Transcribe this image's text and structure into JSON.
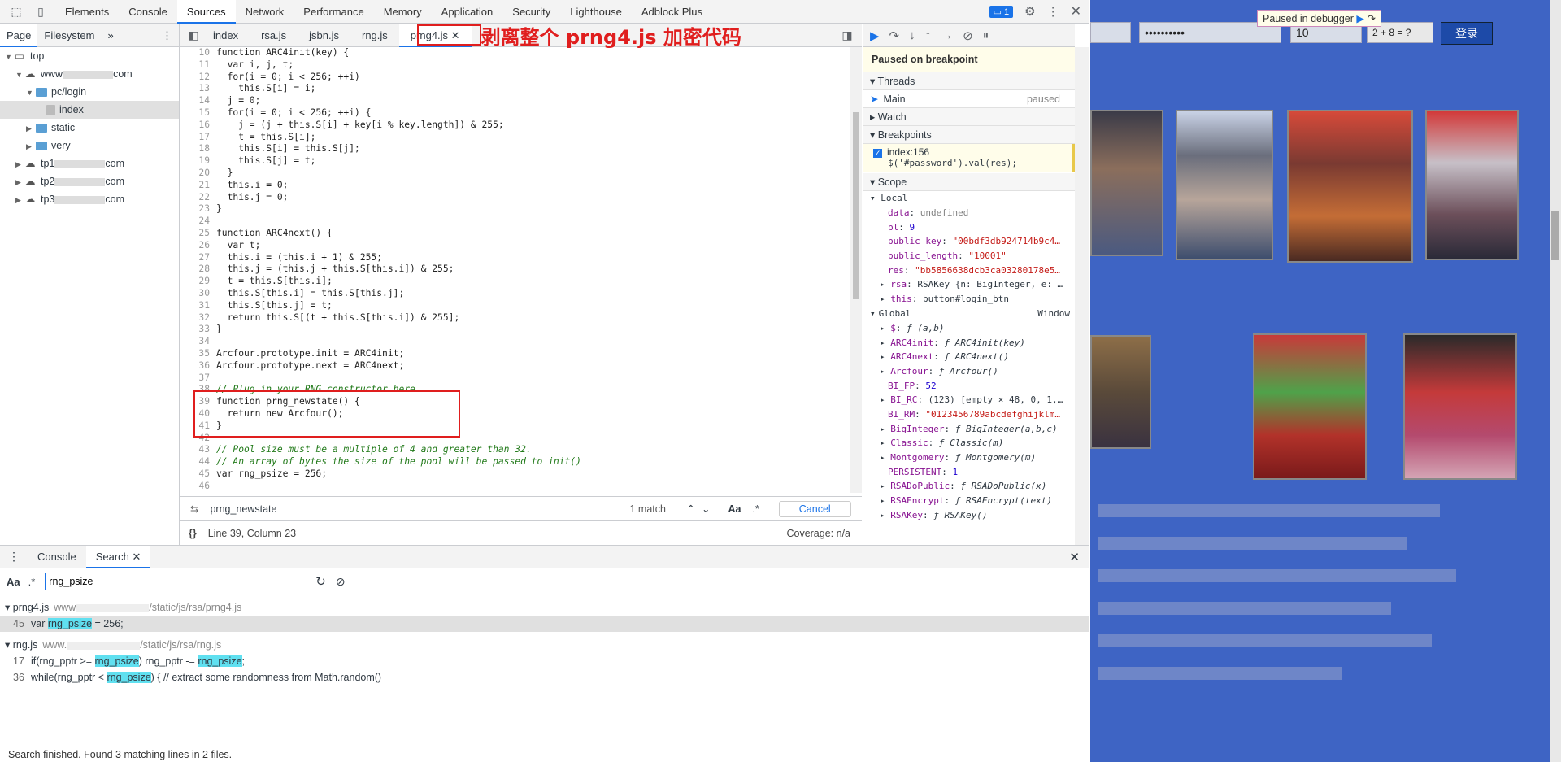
{
  "main_tabs": [
    "Elements",
    "Console",
    "Sources",
    "Network",
    "Performance",
    "Memory",
    "Application",
    "Security",
    "Lighthouse",
    "Adblock Plus"
  ],
  "issues_count": "1",
  "sidebar": {
    "tabs": [
      "Page",
      "Filesystem"
    ],
    "tree": [
      {
        "label": "top",
        "level": 0,
        "arrow": "▼"
      },
      {
        "label": "www",
        "suffix": "com",
        "level": 1,
        "arrow": "▼"
      },
      {
        "label": "pc/login",
        "level": 2,
        "arrow": "▼"
      },
      {
        "label": "index",
        "level": 3,
        "arrow": ""
      },
      {
        "label": "static",
        "level": 2,
        "arrow": "▶"
      },
      {
        "label": "very",
        "level": 2,
        "arrow": "▶"
      },
      {
        "label": "tp1",
        "suffix": "com",
        "level": 1,
        "arrow": "▶"
      },
      {
        "label": "tp2",
        "suffix": "com",
        "level": 1,
        "arrow": "▶"
      },
      {
        "label": "tp3",
        "suffix": "com",
        "level": 1,
        "arrow": "▶"
      }
    ]
  },
  "editor_tabs": [
    "index",
    "rsa.js",
    "jsbn.js",
    "rng.js",
    "prng4.js"
  ],
  "annotation": "剥离整个 prng4.js 加密代码",
  "code_lines": [
    {
      "n": "10",
      "t": "function ARC4init(key) {"
    },
    {
      "n": "11",
      "t": "  var i, j, t;"
    },
    {
      "n": "12",
      "t": "  for(i = 0; i < 256; ++i)"
    },
    {
      "n": "13",
      "t": "    this.S[i] = i;"
    },
    {
      "n": "14",
      "t": "  j = 0;"
    },
    {
      "n": "15",
      "t": "  for(i = 0; i < 256; ++i) {"
    },
    {
      "n": "16",
      "t": "    j = (j + this.S[i] + key[i % key.length]) & 255;"
    },
    {
      "n": "17",
      "t": "    t = this.S[i];"
    },
    {
      "n": "18",
      "t": "    this.S[i] = this.S[j];"
    },
    {
      "n": "19",
      "t": "    this.S[j] = t;"
    },
    {
      "n": "20",
      "t": "  }"
    },
    {
      "n": "21",
      "t": "  this.i = 0;"
    },
    {
      "n": "22",
      "t": "  this.j = 0;"
    },
    {
      "n": "23",
      "t": "}"
    },
    {
      "n": "24",
      "t": ""
    },
    {
      "n": "25",
      "t": "function ARC4next() {"
    },
    {
      "n": "26",
      "t": "  var t;"
    },
    {
      "n": "27",
      "t": "  this.i = (this.i + 1) & 255;"
    },
    {
      "n": "28",
      "t": "  this.j = (this.j + this.S[this.i]) & 255;"
    },
    {
      "n": "29",
      "t": "  t = this.S[this.i];"
    },
    {
      "n": "30",
      "t": "  this.S[this.i] = this.S[this.j];"
    },
    {
      "n": "31",
      "t": "  this.S[this.j] = t;"
    },
    {
      "n": "32",
      "t": "  return this.S[(t + this.S[this.i]) & 255];"
    },
    {
      "n": "33",
      "t": "}"
    },
    {
      "n": "34",
      "t": ""
    },
    {
      "n": "35",
      "t": "Arcfour.prototype.init = ARC4init;"
    },
    {
      "n": "36",
      "t": "Arcfour.prototype.next = ARC4next;"
    },
    {
      "n": "37",
      "t": ""
    },
    {
      "n": "38",
      "t": "// Plug in your RNG constructor here",
      "c": true
    },
    {
      "n": "39",
      "t": "function prng_newstate() {"
    },
    {
      "n": "40",
      "t": "  return new Arcfour();"
    },
    {
      "n": "41",
      "t": "}"
    },
    {
      "n": "42",
      "t": ""
    },
    {
      "n": "43",
      "t": "// Pool size must be a multiple of 4 and greater than 32.",
      "c": true
    },
    {
      "n": "44",
      "t": "// An array of bytes the size of the pool will be passed to init()",
      "c": true
    },
    {
      "n": "45",
      "t": "var rng_psize = 256;"
    },
    {
      "n": "46",
      "t": ""
    }
  ],
  "find": {
    "query": "prng_newstate",
    "matches": "1 match",
    "case_label": "Aa",
    "regex_label": ".*",
    "cancel": "Cancel"
  },
  "status": {
    "position": "Line 39, Column 23",
    "coverage": "Coverage: n/a"
  },
  "debugger": {
    "paused_label": "Paused on breakpoint",
    "threads_label": "Threads",
    "thread_name": "Main",
    "thread_state": "paused",
    "watch_label": "Watch",
    "breakpoints_label": "Breakpoints",
    "breakpoint_file": "index:156",
    "breakpoint_code": "$('#password').val(res);",
    "scope_label": "Scope",
    "local_label": "Local",
    "global_label": "Global",
    "global_value": "Window",
    "local_vars": [
      {
        "k": "data",
        "v": "undefined",
        "type": "undef"
      },
      {
        "k": "pl",
        "v": "9",
        "type": "num"
      },
      {
        "k": "public_key",
        "v": "\"00bdf3db924714b9c4…",
        "type": "str"
      },
      {
        "k": "public_length",
        "v": "\"10001\"",
        "type": "str"
      },
      {
        "k": "res",
        "v": "\"bb5856638dcb3ca03280178e5…",
        "type": "str"
      },
      {
        "k": "rsa",
        "v": "RSAKey {n: BigInteger, e: …",
        "type": "obj",
        "arrow": true
      },
      {
        "k": "this",
        "v": "button#login_btn",
        "type": "obj",
        "arrow": true
      }
    ],
    "global_vars": [
      {
        "k": "$",
        "v": "ƒ (a,b)",
        "arrow": true
      },
      {
        "k": "ARC4init",
        "v": "ƒ ARC4init(key)",
        "arrow": true
      },
      {
        "k": "ARC4next",
        "v": "ƒ ARC4next()",
        "arrow": true
      },
      {
        "k": "Arcfour",
        "v": "ƒ Arcfour()",
        "arrow": true
      },
      {
        "k": "BI_FP",
        "v": "52",
        "type": "num"
      },
      {
        "k": "BI_RC",
        "v": "(123) [empty × 48, 0, 1,…",
        "arrow": true
      },
      {
        "k": "BI_RM",
        "v": "\"0123456789abcdefghijklm…",
        "type": "str"
      },
      {
        "k": "BigInteger",
        "v": "ƒ BigInteger(a,b,c)",
        "arrow": true
      },
      {
        "k": "Classic",
        "v": "ƒ Classic(m)",
        "arrow": true
      },
      {
        "k": "Montgomery",
        "v": "ƒ Montgomery(m)",
        "arrow": true
      },
      {
        "k": "PERSISTENT",
        "v": "1",
        "type": "num"
      },
      {
        "k": "RSADoPublic",
        "v": "ƒ RSADoPublic(x)",
        "arrow": true
      },
      {
        "k": "RSAEncrypt",
        "v": "ƒ RSAEncrypt(text)",
        "arrow": true
      },
      {
        "k": "RSAKey",
        "v": "ƒ RSAKey()",
        "arrow": true
      }
    ]
  },
  "drawer": {
    "tabs": [
      "Console",
      "Search"
    ],
    "case_label": "Aa",
    "regex_label": ".*",
    "query": "rng_psize",
    "results": [
      {
        "file": "prng4.js",
        "path": "www",
        "path_end": "/static/js/rsa/prng4.js",
        "lines": [
          {
            "n": "45",
            "parts": [
              "var ",
              "rng_psize",
              " = 256;"
            ],
            "sel": true
          }
        ]
      },
      {
        "file": "rng.js",
        "path": "www.",
        "path_end": "/static/js/rsa/rng.js",
        "lines": [
          {
            "n": "17",
            "parts": [
              "if(rng_pptr >= ",
              "rng_psize",
              ") rng_pptr -= ",
              "rng_psize",
              ";"
            ]
          },
          {
            "n": "36",
            "parts": [
              "while(rng_pptr < ",
              "rng_psize",
              ") {  // extract some randomness from Math.random()"
            ]
          }
        ]
      }
    ],
    "status": "Search finished.  Found 3 matching lines in 2 files."
  },
  "webpage": {
    "banner": "Paused in debugger",
    "password_value": "••••••••••",
    "captcha_input": "10",
    "captcha_text": "2 + 8 = ?",
    "login_label": "登录"
  }
}
